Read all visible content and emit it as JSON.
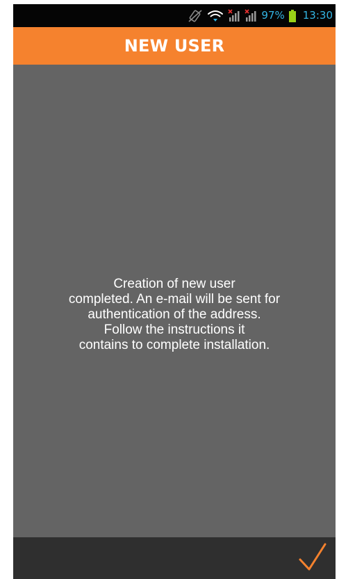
{
  "status_bar": {
    "battery_percent": "97%",
    "time": "13:30",
    "icons": [
      "vibrate-icon",
      "wifi-icon",
      "signal-no-sim-icon",
      "signal-no-sim-icon",
      "battery-icon"
    ],
    "text_color": "#33b5e5"
  },
  "header": {
    "title": "NEW USER",
    "color": "#f5822e"
  },
  "main": {
    "message": "Creation of new user\ncompleted. An e-mail will be sent for\nauthentication of the address.\nFollow the instructions it\ncontains to complete installation.",
    "background": "#646464"
  },
  "footer": {
    "confirm_icon": "checkmark-icon",
    "accent": "#f5822e"
  }
}
